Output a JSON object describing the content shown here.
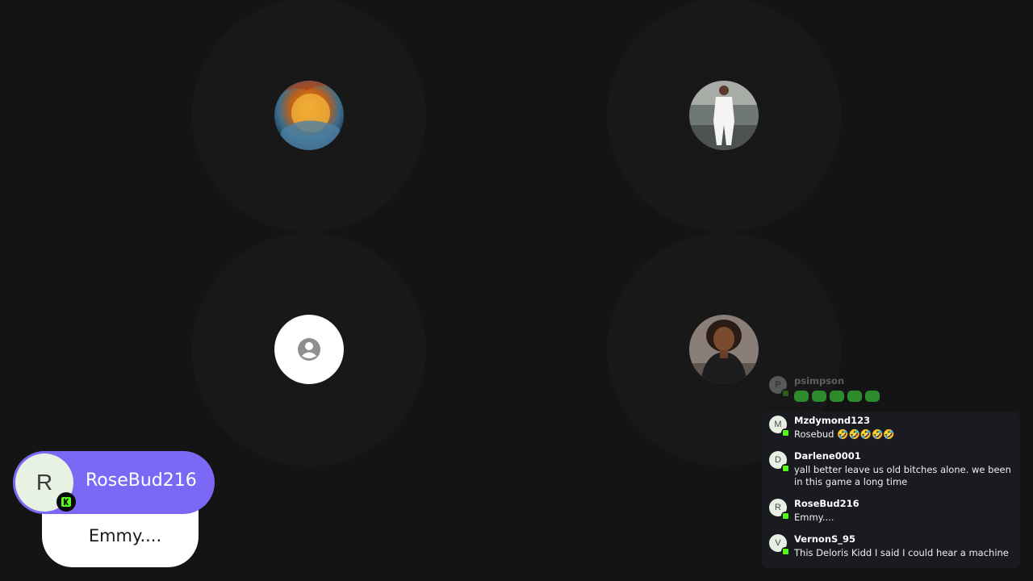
{
  "speaker": {
    "initial": "R",
    "name": "RoseBud216",
    "message": "Emmy...."
  },
  "seats": [
    {
      "avatar": "globe-fire-image"
    },
    {
      "avatar": "person-white-outfit-image"
    },
    {
      "avatar": "default-person-icon"
    },
    {
      "avatar": "woman-leather-jacket-image"
    }
  ],
  "chat": {
    "messages": [
      {
        "initial": "P",
        "user": "psimpson",
        "text": ""
      },
      {
        "initial": "M",
        "user": "Mzdymond123",
        "text": "Rosebud 🤣🤣🤣🤣🤣"
      },
      {
        "initial": "D",
        "user": "Darlene0001",
        "text": "yall better leave us old bitches alone. we been in this game a long time"
      },
      {
        "initial": "R",
        "user": "RoseBud216",
        "text": "Emmy...."
      },
      {
        "initial": "V",
        "user": "VernonS_95",
        "text": "This Deloris Kidd I said I could hear a machine"
      }
    ]
  },
  "colors": {
    "background": "#141414",
    "speaker_pill": "#7b68f5",
    "badge_green": "#53fc18"
  }
}
